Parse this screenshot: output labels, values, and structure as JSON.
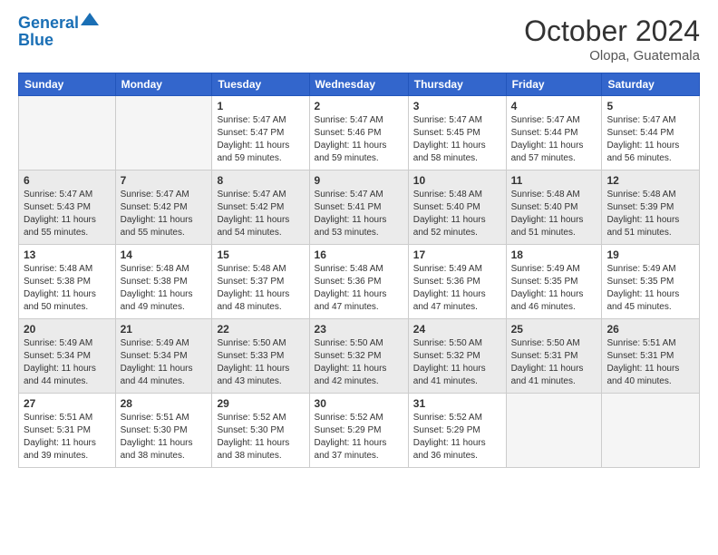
{
  "header": {
    "logo_line1": "General",
    "logo_line2": "Blue",
    "month": "October 2024",
    "location": "Olopa, Guatemala"
  },
  "days_of_week": [
    "Sunday",
    "Monday",
    "Tuesday",
    "Wednesday",
    "Thursday",
    "Friday",
    "Saturday"
  ],
  "weeks": [
    [
      {
        "day": "",
        "empty": true
      },
      {
        "day": "",
        "empty": true
      },
      {
        "day": "1",
        "sunrise": "Sunrise: 5:47 AM",
        "sunset": "Sunset: 5:47 PM",
        "daylight": "Daylight: 11 hours and 59 minutes."
      },
      {
        "day": "2",
        "sunrise": "Sunrise: 5:47 AM",
        "sunset": "Sunset: 5:46 PM",
        "daylight": "Daylight: 11 hours and 59 minutes."
      },
      {
        "day": "3",
        "sunrise": "Sunrise: 5:47 AM",
        "sunset": "Sunset: 5:45 PM",
        "daylight": "Daylight: 11 hours and 58 minutes."
      },
      {
        "day": "4",
        "sunrise": "Sunrise: 5:47 AM",
        "sunset": "Sunset: 5:44 PM",
        "daylight": "Daylight: 11 hours and 57 minutes."
      },
      {
        "day": "5",
        "sunrise": "Sunrise: 5:47 AM",
        "sunset": "Sunset: 5:44 PM",
        "daylight": "Daylight: 11 hours and 56 minutes."
      }
    ],
    [
      {
        "day": "6",
        "sunrise": "Sunrise: 5:47 AM",
        "sunset": "Sunset: 5:43 PM",
        "daylight": "Daylight: 11 hours and 55 minutes."
      },
      {
        "day": "7",
        "sunrise": "Sunrise: 5:47 AM",
        "sunset": "Sunset: 5:42 PM",
        "daylight": "Daylight: 11 hours and 55 minutes."
      },
      {
        "day": "8",
        "sunrise": "Sunrise: 5:47 AM",
        "sunset": "Sunset: 5:42 PM",
        "daylight": "Daylight: 11 hours and 54 minutes."
      },
      {
        "day": "9",
        "sunrise": "Sunrise: 5:47 AM",
        "sunset": "Sunset: 5:41 PM",
        "daylight": "Daylight: 11 hours and 53 minutes."
      },
      {
        "day": "10",
        "sunrise": "Sunrise: 5:48 AM",
        "sunset": "Sunset: 5:40 PM",
        "daylight": "Daylight: 11 hours and 52 minutes."
      },
      {
        "day": "11",
        "sunrise": "Sunrise: 5:48 AM",
        "sunset": "Sunset: 5:40 PM",
        "daylight": "Daylight: 11 hours and 51 minutes."
      },
      {
        "day": "12",
        "sunrise": "Sunrise: 5:48 AM",
        "sunset": "Sunset: 5:39 PM",
        "daylight": "Daylight: 11 hours and 51 minutes."
      }
    ],
    [
      {
        "day": "13",
        "sunrise": "Sunrise: 5:48 AM",
        "sunset": "Sunset: 5:38 PM",
        "daylight": "Daylight: 11 hours and 50 minutes."
      },
      {
        "day": "14",
        "sunrise": "Sunrise: 5:48 AM",
        "sunset": "Sunset: 5:38 PM",
        "daylight": "Daylight: 11 hours and 49 minutes."
      },
      {
        "day": "15",
        "sunrise": "Sunrise: 5:48 AM",
        "sunset": "Sunset: 5:37 PM",
        "daylight": "Daylight: 11 hours and 48 minutes."
      },
      {
        "day": "16",
        "sunrise": "Sunrise: 5:48 AM",
        "sunset": "Sunset: 5:36 PM",
        "daylight": "Daylight: 11 hours and 47 minutes."
      },
      {
        "day": "17",
        "sunrise": "Sunrise: 5:49 AM",
        "sunset": "Sunset: 5:36 PM",
        "daylight": "Daylight: 11 hours and 47 minutes."
      },
      {
        "day": "18",
        "sunrise": "Sunrise: 5:49 AM",
        "sunset": "Sunset: 5:35 PM",
        "daylight": "Daylight: 11 hours and 46 minutes."
      },
      {
        "day": "19",
        "sunrise": "Sunrise: 5:49 AM",
        "sunset": "Sunset: 5:35 PM",
        "daylight": "Daylight: 11 hours and 45 minutes."
      }
    ],
    [
      {
        "day": "20",
        "sunrise": "Sunrise: 5:49 AM",
        "sunset": "Sunset: 5:34 PM",
        "daylight": "Daylight: 11 hours and 44 minutes."
      },
      {
        "day": "21",
        "sunrise": "Sunrise: 5:49 AM",
        "sunset": "Sunset: 5:34 PM",
        "daylight": "Daylight: 11 hours and 44 minutes."
      },
      {
        "day": "22",
        "sunrise": "Sunrise: 5:50 AM",
        "sunset": "Sunset: 5:33 PM",
        "daylight": "Daylight: 11 hours and 43 minutes."
      },
      {
        "day": "23",
        "sunrise": "Sunrise: 5:50 AM",
        "sunset": "Sunset: 5:32 PM",
        "daylight": "Daylight: 11 hours and 42 minutes."
      },
      {
        "day": "24",
        "sunrise": "Sunrise: 5:50 AM",
        "sunset": "Sunset: 5:32 PM",
        "daylight": "Daylight: 11 hours and 41 minutes."
      },
      {
        "day": "25",
        "sunrise": "Sunrise: 5:50 AM",
        "sunset": "Sunset: 5:31 PM",
        "daylight": "Daylight: 11 hours and 41 minutes."
      },
      {
        "day": "26",
        "sunrise": "Sunrise: 5:51 AM",
        "sunset": "Sunset: 5:31 PM",
        "daylight": "Daylight: 11 hours and 40 minutes."
      }
    ],
    [
      {
        "day": "27",
        "sunrise": "Sunrise: 5:51 AM",
        "sunset": "Sunset: 5:31 PM",
        "daylight": "Daylight: 11 hours and 39 minutes."
      },
      {
        "day": "28",
        "sunrise": "Sunrise: 5:51 AM",
        "sunset": "Sunset: 5:30 PM",
        "daylight": "Daylight: 11 hours and 38 minutes."
      },
      {
        "day": "29",
        "sunrise": "Sunrise: 5:52 AM",
        "sunset": "Sunset: 5:30 PM",
        "daylight": "Daylight: 11 hours and 38 minutes."
      },
      {
        "day": "30",
        "sunrise": "Sunrise: 5:52 AM",
        "sunset": "Sunset: 5:29 PM",
        "daylight": "Daylight: 11 hours and 37 minutes."
      },
      {
        "day": "31",
        "sunrise": "Sunrise: 5:52 AM",
        "sunset": "Sunset: 5:29 PM",
        "daylight": "Daylight: 11 hours and 36 minutes."
      },
      {
        "day": "",
        "empty": true
      },
      {
        "day": "",
        "empty": true
      }
    ]
  ]
}
